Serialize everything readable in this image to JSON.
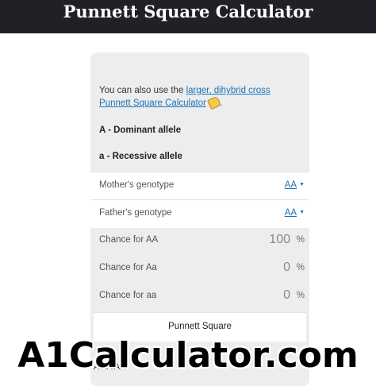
{
  "header": {
    "title": "Punnett Square Calculator"
  },
  "intro": {
    "prefix": "You can also use the ",
    "link_text": "larger, dihybrid cross Punnett Square Calculator",
    "icon": "tag-icon",
    "suffix": "."
  },
  "alleles": {
    "dominant": "A - Dominant allele",
    "recessive": "a - Recessive allele"
  },
  "genotypes": {
    "mother_label": "Mother's genotype",
    "mother_value": "AA",
    "father_label": "Father's genotype",
    "father_value": "AA"
  },
  "chances": [
    {
      "label": "Chance for AA",
      "value": "100",
      "unit": "%"
    },
    {
      "label": "Chance for Aa",
      "value": "0",
      "unit": "%"
    },
    {
      "label": "Chance for aa",
      "value": "0",
      "unit": "%"
    }
  ],
  "punnett_button": "Punnett Square",
  "grid_peek": "A   AA AA",
  "watermark": "A1Calculator.com",
  "colors": {
    "header_bg": "#1f2126",
    "link": "#1a73b8",
    "card_bg": "#ededed"
  }
}
